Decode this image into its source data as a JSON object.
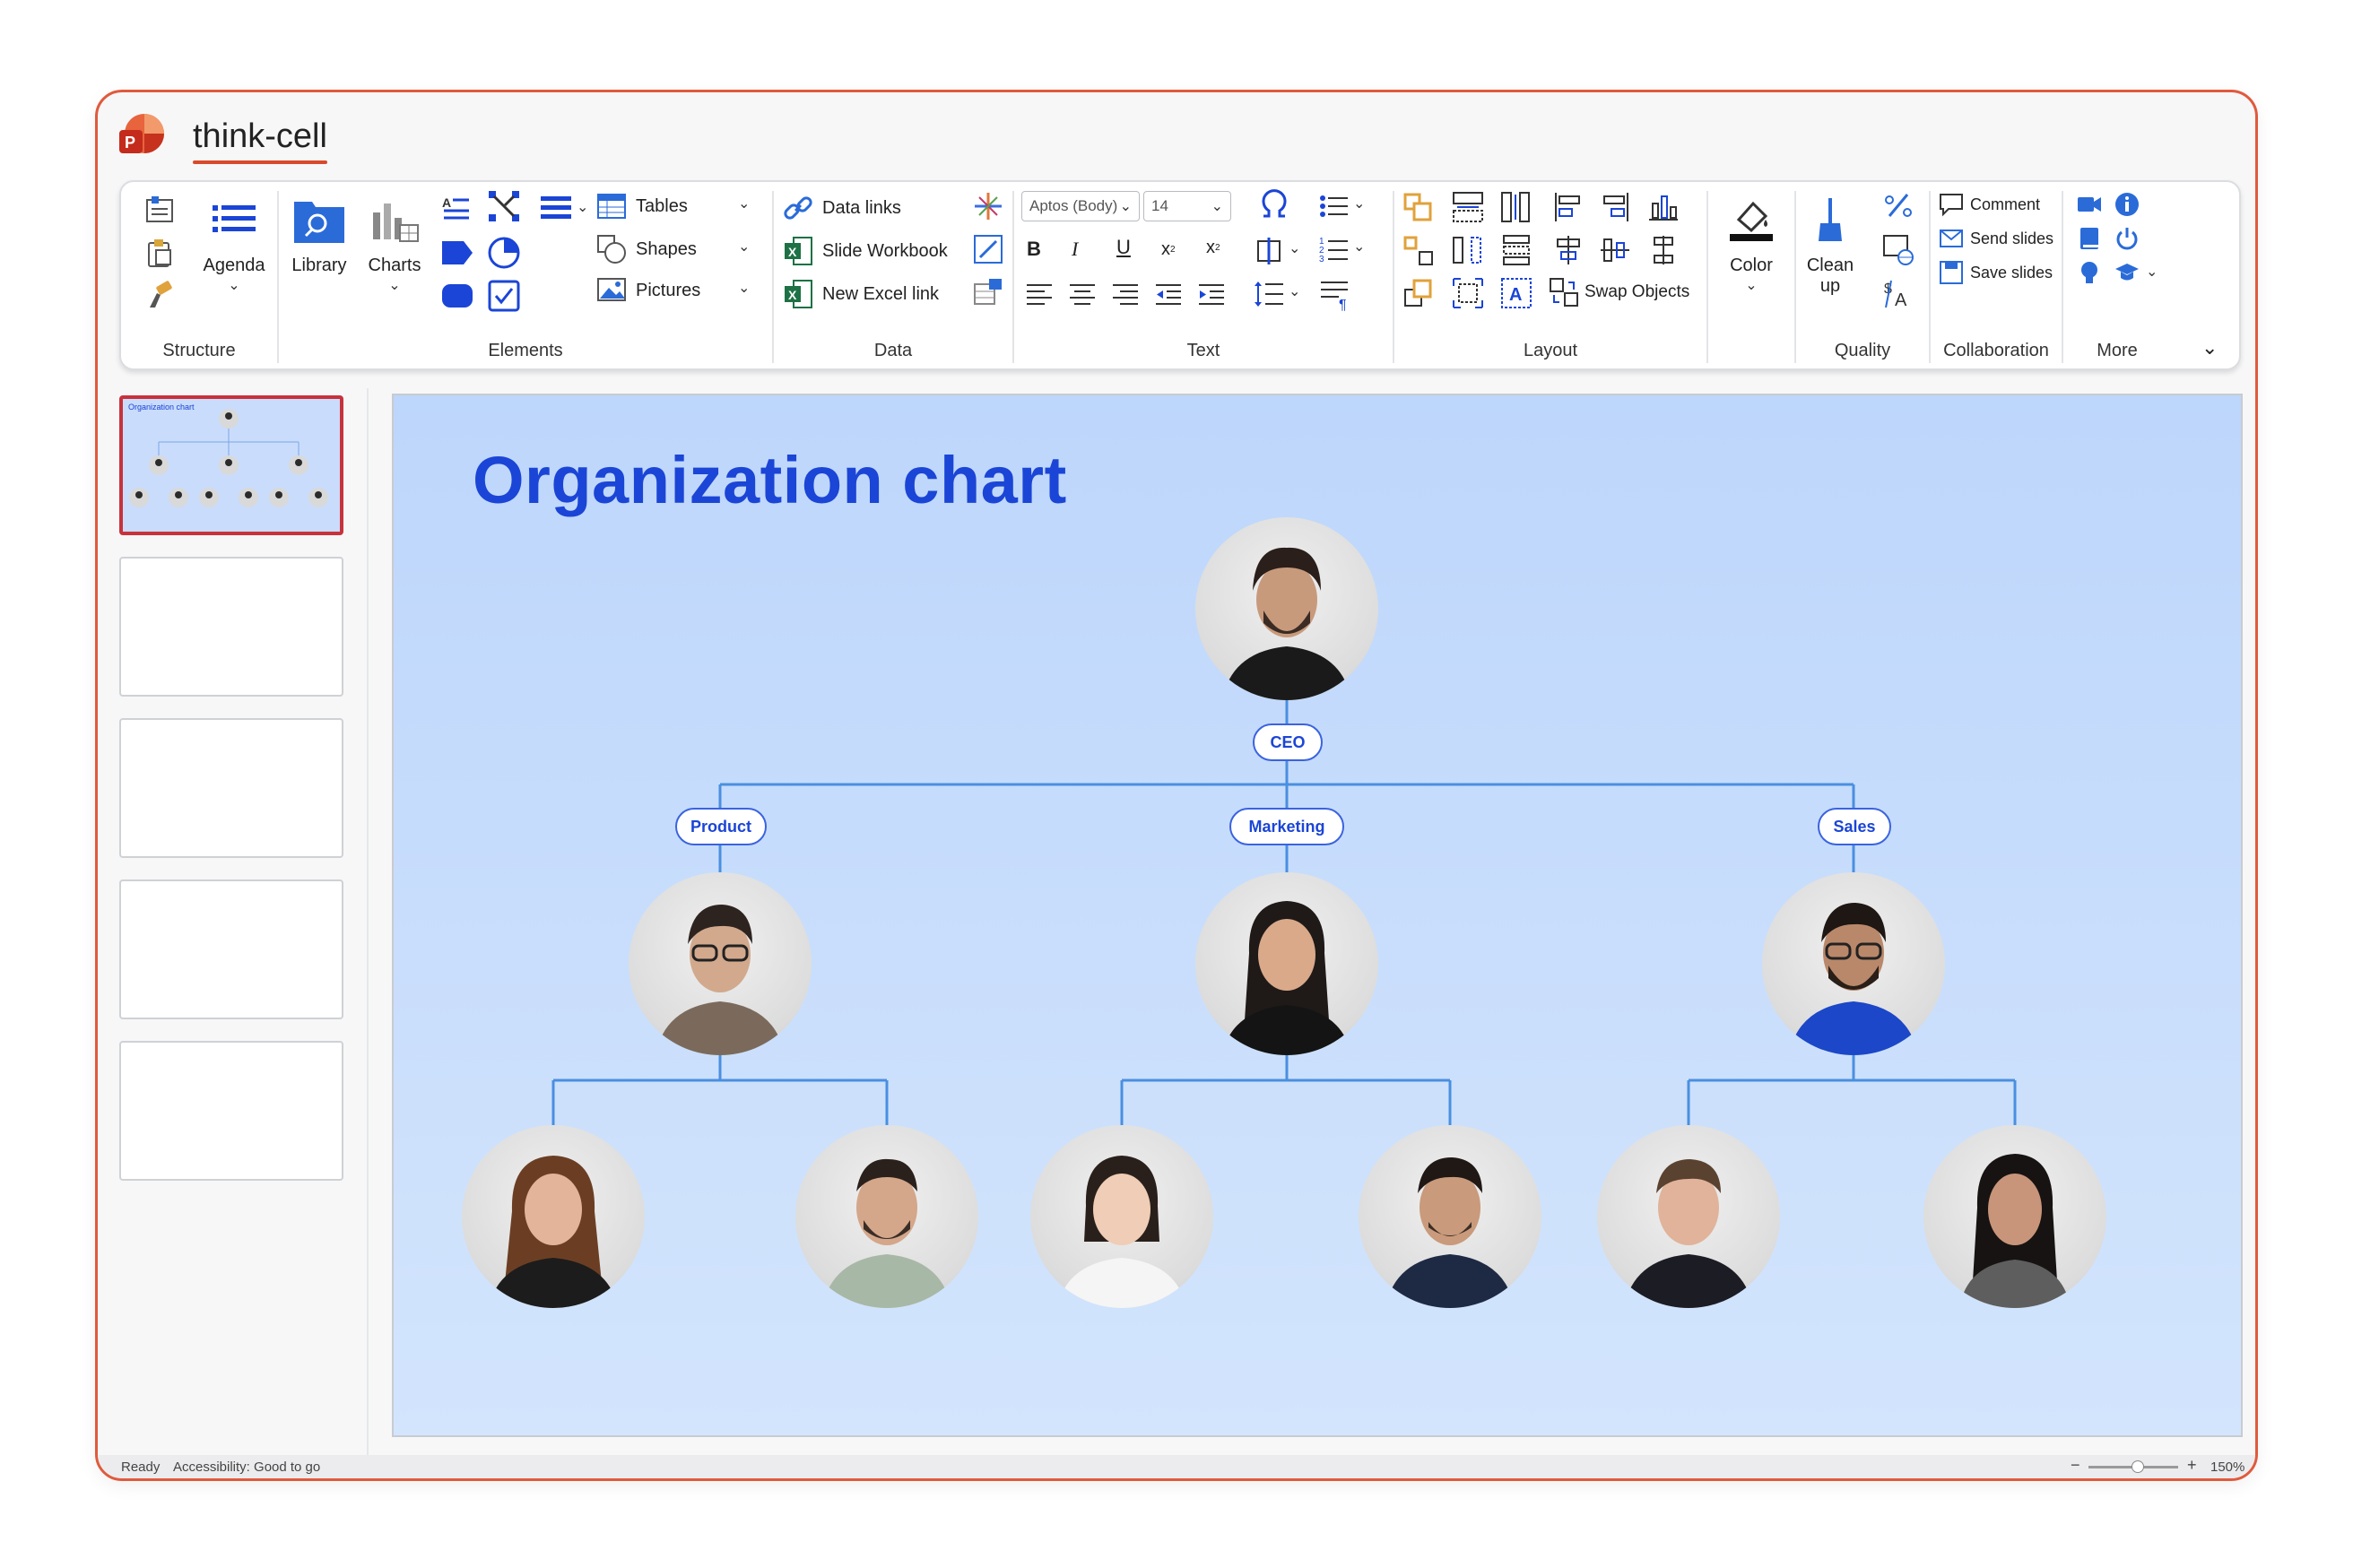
{
  "app": {
    "title": "think-cell"
  },
  "ribbon": {
    "groups": {
      "structure": "Structure",
      "elements": "Elements",
      "data": "Data",
      "text": "Text",
      "layout": "Layout",
      "quality": "Quality",
      "collaboration": "Collaboration",
      "more": "More"
    },
    "agenda": "Agenda",
    "library": "Library",
    "charts": "Charts",
    "tables": "Tables",
    "shapes": "Shapes",
    "pictures": "Pictures",
    "data_links": "Data links",
    "slide_workbook": "Slide Workbook",
    "new_excel_link": "New Excel link",
    "font_name": "Aptos (Body)",
    "font_size": "14",
    "bold": "B",
    "italic": "I",
    "underline": "U",
    "subscript": "x",
    "superscript": "x",
    "swap_objects": "Swap Objects",
    "color": "Color",
    "clean_up_1": "Clean",
    "clean_up_2": "up",
    "comment": "Comment",
    "send_slides": "Send slides",
    "save_slides": "Save slides"
  },
  "thumbnails": {
    "slide1_title": "Organization chart"
  },
  "slide": {
    "title": "Organization chart",
    "tags": {
      "ceo": "CEO",
      "product": "Product",
      "marketing": "Marketing",
      "sales": "Sales"
    }
  },
  "status": {
    "ready": "Ready",
    "accessibility": "Accessibility: Good to go",
    "zoom": "150%",
    "zoom_minus": "−",
    "zoom_plus": "+"
  },
  "colors": {
    "accent": "#1b45d6",
    "window_border": "#e05a3c",
    "selected_thumb": "#c8323c",
    "connector": "#4a8fe0"
  }
}
